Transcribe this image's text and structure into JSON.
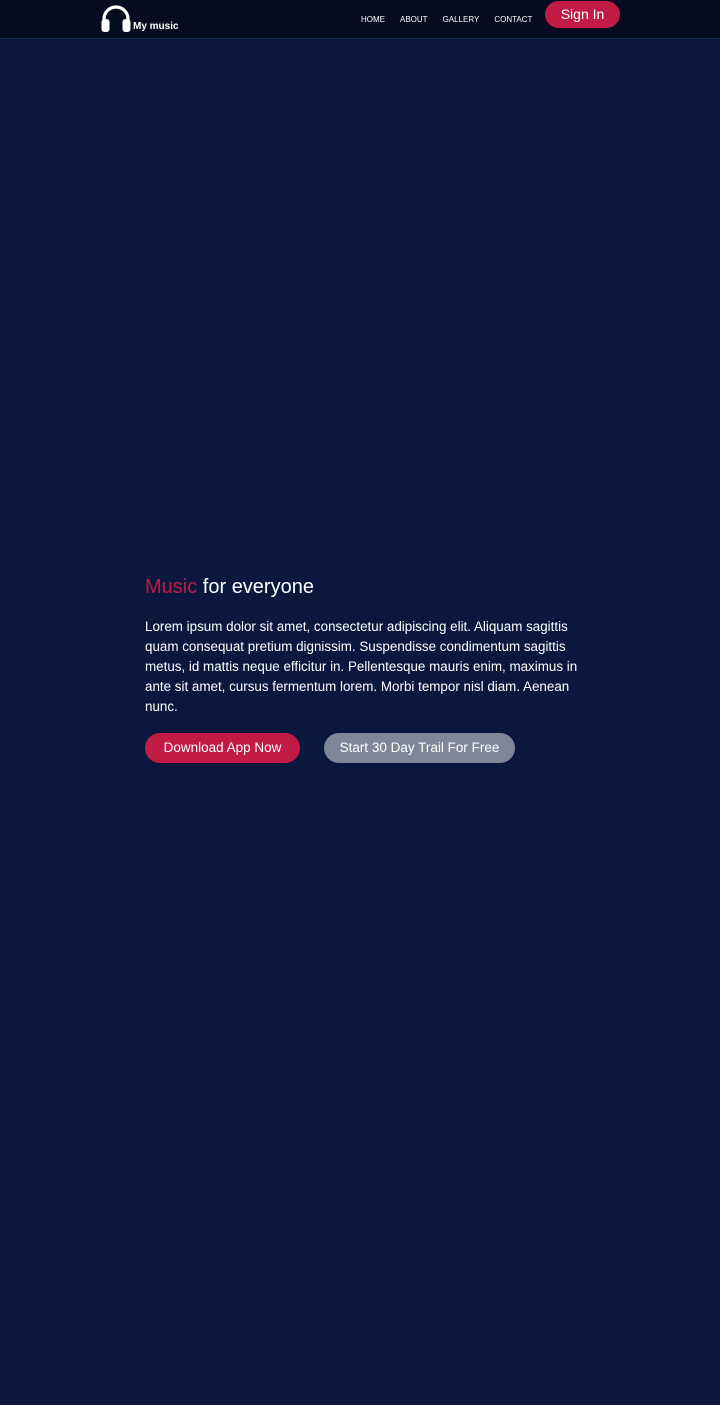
{
  "navbar": {
    "logo_icon": "headphones-icon",
    "brand": "My music",
    "links": [
      "HOME",
      "ABOUT",
      "GALLERY",
      "CONTACT"
    ],
    "sign_in_label": "Sign In"
  },
  "hero": {
    "title_accent": "Music",
    "title_rest": " for everyone",
    "text": "Lorem ipsum dolor sit amet, consectetur adipiscing elit. Aliquam sagittis quam consequat pretium dignissim. Suspendisse condimentum sagittis metus, id mattis neque efficitur in. Pellentesque mauris enim, maximus in ante sit amet, cursus fermentum lorem. Morbi tempor nisl diam. Aenean nunc.",
    "download_label": "Download App Now",
    "trial_label": "Start 30 Day Trail For Free"
  },
  "colors": {
    "background": "#0b183d",
    "navbar": "#060c20",
    "accent": "#c01a45",
    "secondary_button": "#7f8699"
  }
}
